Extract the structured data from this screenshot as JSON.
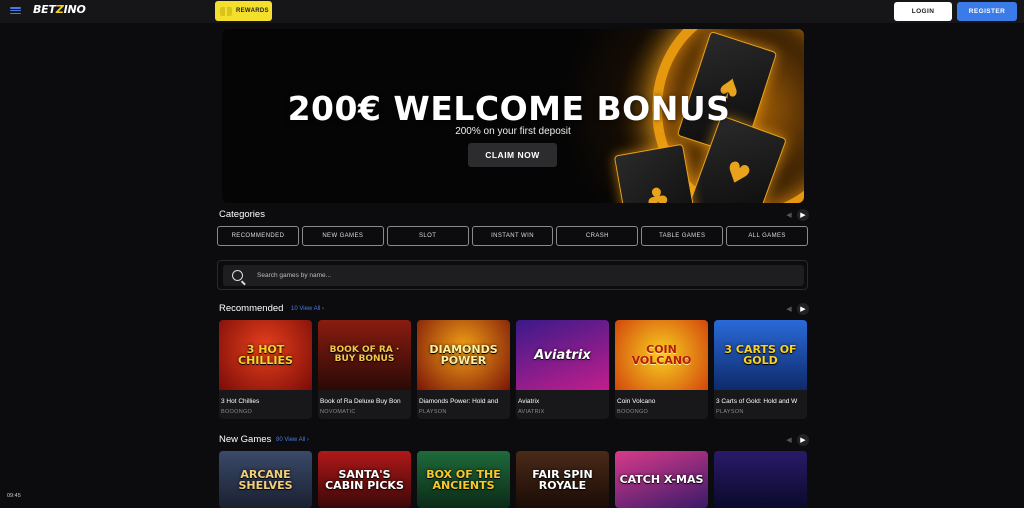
{
  "header": {
    "logo_left": "BET",
    "logo_z": "Z",
    "logo_right": "INO",
    "rewards_label": "REWARDS",
    "login_label": "LOGIN",
    "register_label": "REGISTER"
  },
  "hero": {
    "title": "200€ WELCOME BONUS",
    "subtitle": "200% on your first deposit",
    "cta_label": "CLAIM NOW"
  },
  "categories": {
    "title": "Categories",
    "items": [
      "RECOMMENDED",
      "NEW GAMES",
      "SLOT",
      "INSTANT WIN",
      "CRASH",
      "TABLE GAMES",
      "ALL GAMES"
    ]
  },
  "search": {
    "placeholder": "Search games by name..."
  },
  "recommended": {
    "title": "Recommended",
    "view_all": "10 View All",
    "games": [
      {
        "thumb": "3 HOT CHILLIES",
        "name": "3 Hot Chillies",
        "provider": "BOOONGO"
      },
      {
        "thumb": "BOOK OF RA · BUY BONUS",
        "name": "Book of Ra Deluxe Buy Bon",
        "provider": "NOVOMATIC"
      },
      {
        "thumb": "DIAMONDS POWER",
        "name": "Diamonds Power: Hold and",
        "provider": "PLAYSON"
      },
      {
        "thumb": "Aviatrix",
        "name": "Aviatrix",
        "provider": "AVIATRIX"
      },
      {
        "thumb": "COIN VOLCANO",
        "name": "Coin Volcano",
        "provider": "BOOONGO"
      },
      {
        "thumb": "3 CARTS OF GOLD",
        "name": "3 Carts of Gold: Hold and W",
        "provider": "PLAYSON"
      }
    ]
  },
  "new_games": {
    "title": "New Games",
    "view_all": "80 View All",
    "games": [
      {
        "thumb": "ARCANE SHELVES"
      },
      {
        "thumb": "SANTA'S CABIN PICKS"
      },
      {
        "thumb": "BOX OF THE ANCIENTS"
      },
      {
        "thumb": "FAIR SPIN ROYALE"
      },
      {
        "thumb": "CATCH X-MAS"
      },
      {
        "thumb": ""
      }
    ]
  },
  "clock": "09:45",
  "colors": {
    "accent": "#3b7be8",
    "rewards": "#f4e02c",
    "background": "#0c0c0e"
  }
}
